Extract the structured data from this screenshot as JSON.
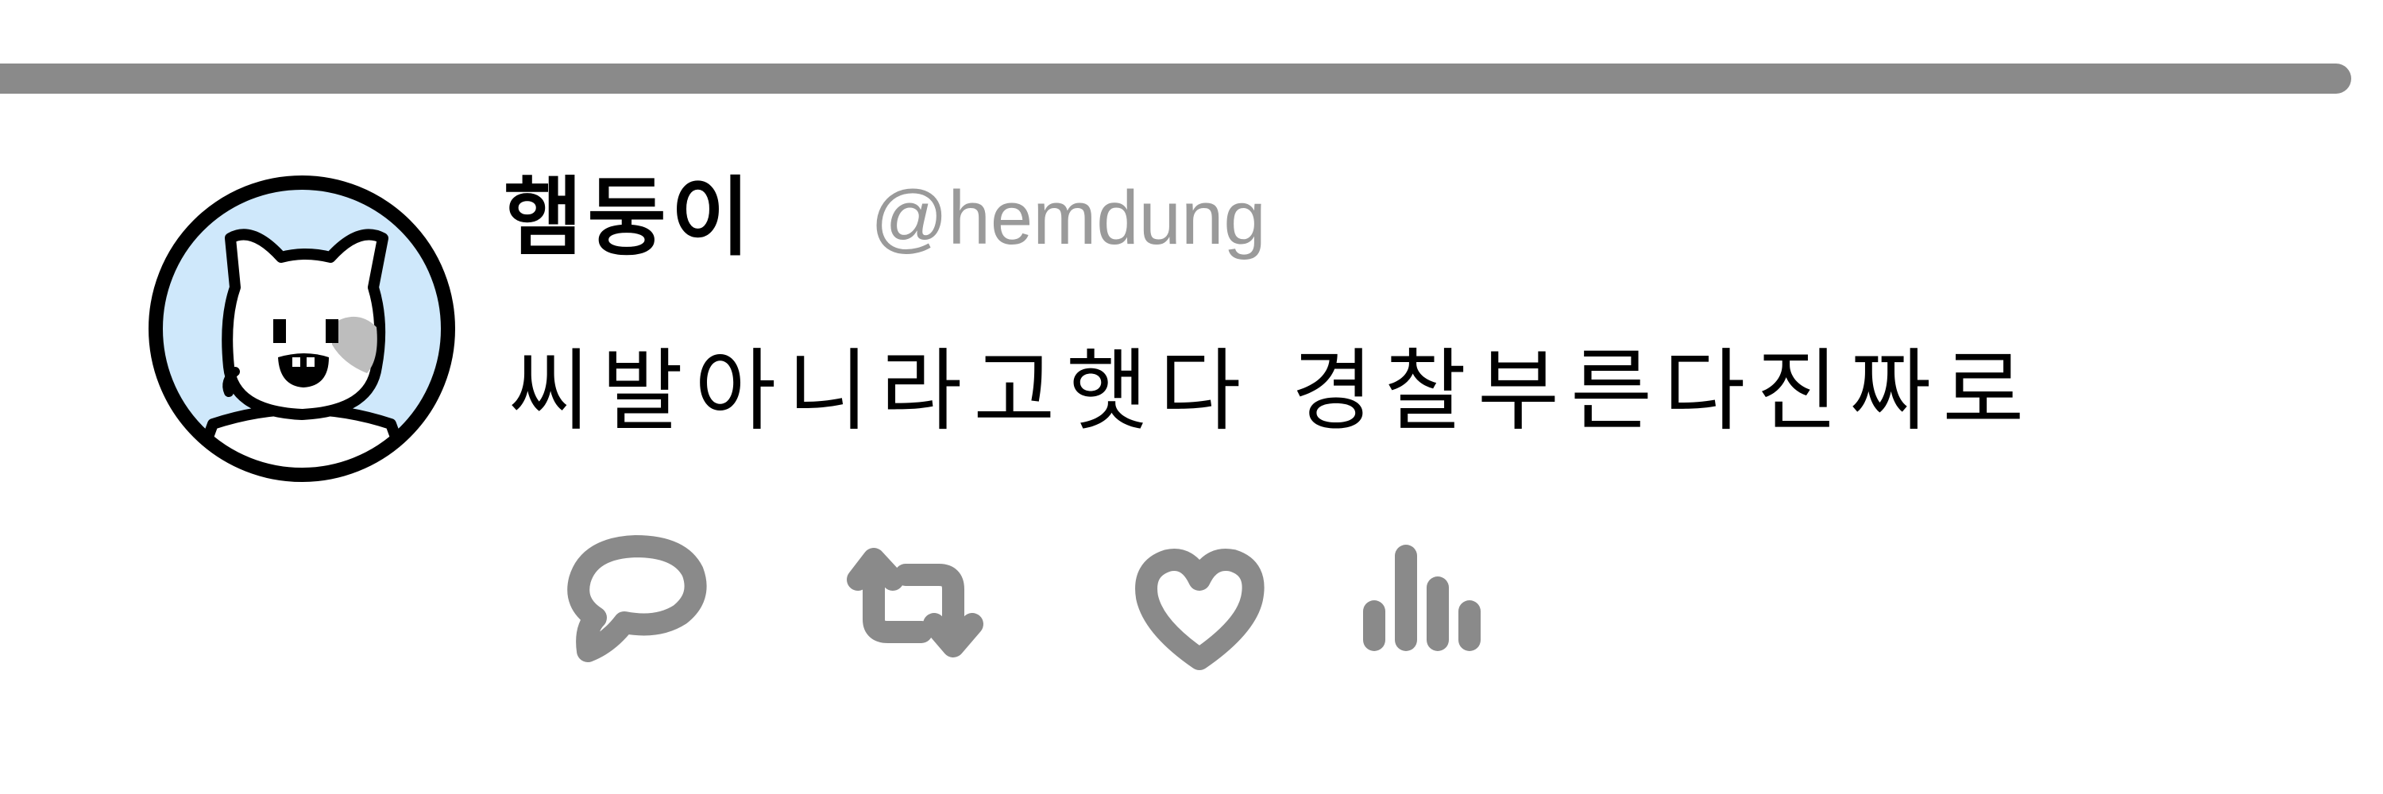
{
  "tweet": {
    "display_name": "햄둥이",
    "handle": "@hemdung",
    "text": "씨발아니라고햇다 경찰부른다진짜로"
  },
  "actions": {
    "reply_icon": "speech-bubble-icon",
    "retweet_icon": "retweet-arrows-icon",
    "like_icon": "heart-icon",
    "views_icon": "bar-chart-icon"
  },
  "colors": {
    "divider": "#8a8a8a",
    "avatar_background": "#cfe8fb",
    "avatar_outline": "#000000",
    "handle": "#9a9a9a",
    "icons": "#8a8a8a",
    "text": "#000000"
  }
}
